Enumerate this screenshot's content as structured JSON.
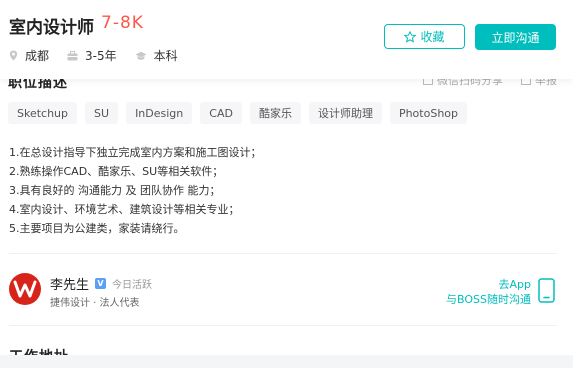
{
  "header": {
    "job_title": "室内设计师",
    "salary": "7-8K",
    "location": "成都",
    "experience": "3-5年",
    "education": "本科",
    "favorite_label": "收藏",
    "chat_label": "立即沟通"
  },
  "section": {
    "description_heading": "职位描述",
    "wechat_share": "微信扫码分享",
    "report": "举报"
  },
  "tags": [
    "Sketchup",
    "SU",
    "InDesign",
    "CAD",
    "酷家乐",
    "设计师助理",
    "PhotoShop"
  ],
  "description": [
    "1.在总设计指导下独立完成室内方案和施工图设计；",
    "2.熟练操作CAD、酷家乐、SU等相关软件；",
    "3.具有良好的 沟通能力 及 团队协作 能力；",
    "4.室内设计、环境艺术、建筑设计等相关专业；",
    "5.主要项目为公建类，家装请绕行。"
  ],
  "recruiter": {
    "name": "李先生",
    "status": "今日活跃",
    "company_role": "捷伟设计 · 法人代表",
    "app_line1": "去App",
    "app_line2": "与BOSS随时沟通"
  },
  "work_address_heading": "工作地址",
  "colors": {
    "accent": "#00bebd",
    "salary": "#fe574a",
    "avatar_bg": "#d8231a"
  }
}
